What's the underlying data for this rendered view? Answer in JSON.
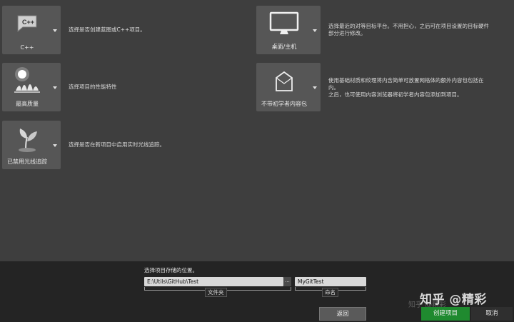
{
  "options": [
    {
      "label": "C++",
      "description": "选择是否创建蓝图或C++项目。",
      "icon": "cpp-icon"
    },
    {
      "label": "最高质量",
      "description": "选择项目的性能特性",
      "icon": "quality-icon"
    },
    {
      "label": "已禁用光线追踪",
      "description": "选择是否在新项目中启用实时光线追踪。",
      "icon": "raytracing-plant-icon"
    },
    {
      "label": "桌面/主机",
      "description_lines": [
        "选择最近的对等目标平台。不用担心，之后可在项目设置的目标硬件",
        "部分进行修改。"
      ],
      "icon": "monitor-icon"
    },
    {
      "label": "不带初学者内容包",
      "description_lines": [
        "使用基础材质和纹理将内含简单可放置网格体的额外内容包包括在",
        "内。",
        "之后，也可使用内容浏览器将初学者内容包添加到项目。"
      ],
      "icon": "content-box-icon"
    }
  ],
  "location": {
    "prompt": "选择项目存储的位置。",
    "folder_value": "E:\\Utils\\GitHub\\Test",
    "browse_label": "...",
    "folder_caption": "文件夹",
    "name_value": "MyGitTest",
    "name_caption": "命名"
  },
  "buttons": {
    "back": "返回",
    "create": "创建项目",
    "cancel": "取消"
  },
  "watermark": "知乎 @精彩",
  "colors": {
    "create": "#1f8a2f",
    "panel": "#3e3e3e",
    "footer": "#242424"
  }
}
